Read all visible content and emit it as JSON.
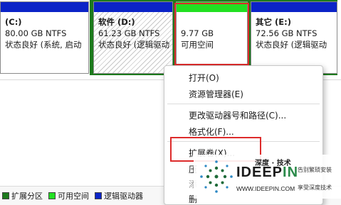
{
  "partitions": [
    {
      "name": "(C:)",
      "size": "80.00 GB NTFS",
      "status": "状态良好 (系统, 启动"
    },
    {
      "name": "软件 (D:)",
      "size": "61.23 GB NTFS",
      "status": "状态良好 (逻辑驱动"
    },
    {
      "name": "",
      "size": "9.77 GB",
      "status": "可用空间"
    },
    {
      "name": "其它 (E:)",
      "size": "72.56 GB NTFS",
      "status": "状态良好 (逻辑驱动"
    }
  ],
  "context_menu": {
    "items": [
      "打开(O)",
      "资源管理器(E)",
      "更改驱动器号和路径(C)...",
      "格式化(F)...",
      "扩展卷(X)...",
      "压",
      "添",
      "删"
    ]
  },
  "legend": [
    {
      "label": "扩展分区",
      "color": "#1c7a1c"
    },
    {
      "label": "可用空间",
      "color": "#22e022"
    },
    {
      "label": "逻辑驱动器",
      "color": "#0b23c7"
    }
  ],
  "watermark": {
    "top": "深度 · 技术",
    "brand_a": "IDEEP",
    "brand_b": "IN",
    "url": "WWW.IDEEPIN.COM",
    "right1": "告别繁琐安装",
    "right2": "享受深度技术"
  },
  "colors": {
    "primary_bar": "#0b23c7",
    "free_bar": "#22e022",
    "extended_border": "#1c7a1c",
    "highlight": "#dd2b2b"
  }
}
